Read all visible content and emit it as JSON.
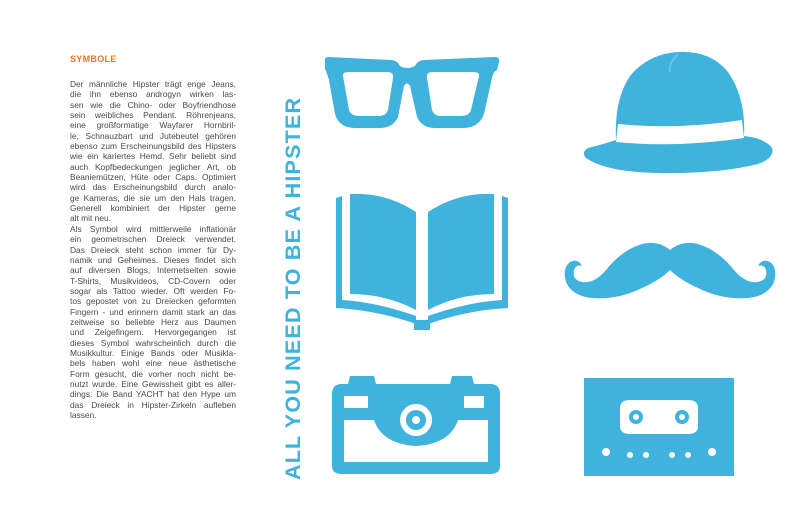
{
  "section_heading": "SYMBOLE",
  "body_lines": [
    "Der männliche Hipster trägt enge Jeans,",
    "die ihn ebenso androgyn wirken las-",
    "sen wie die Chino- oder Boyfriendhose",
    "sein weibliches Pendant. Röhrenjeans,",
    "eine großformatige Wayfarer Hornbril-",
    "le, Schnauzbart und Jutebeutel gehören",
    "ebenso zum Erscheinungsbild des Hipsters",
    "wie ein kariertes Hemd. Sehr beliebt sind",
    "auch Kopfbedeckungen jeglicher Art, ob",
    "Beaniemützen, Hüte oder Caps. Optimiert",
    "wird das Erscheinungsbild durch analo-",
    "ge Kameras, die sie um den Hals tragen.",
    "Generell  kombiniert der Hipster gerne",
    "alt mit neu.",
    "Als Symbol wird mittlerweile inflationär",
    "ein geometrischen Dreieck verwendet.",
    "Das Dreieck steht schon immer für Dy-",
    "namik und Geheimes. Dieses findet sich",
    "auf diversen Blogs, Internetseiten sowie",
    "T-Shirts, Musikvideos, CD-Covern oder",
    "sogar als Tattoo wieder. Oft werden  Fo-",
    "tos gepostet von zu Dreiecken geformten",
    "Fingern - und erinnern damit stark an das",
    "zeitweise so beliebte Herz aus Daumen",
    "und Zeigefingern. Hervorgegangen ist",
    "dieses Symbol wahrscheinlich durch die",
    "Musikkultur. Einige Bands oder Musikla-",
    "bels haben wohl eine neue ästhetische",
    "Form gesucht, die vorher noch nicht be-",
    "nutzt wurde. Eine Gewissheit gibt es aller-",
    "dings: Die Band YACHT hat den Hype um",
    "das Dreieck in Hipster-Zirkeln aufleben",
    "lassen."
  ],
  "vertical_title": "ALL YOU NEED TO BE A HIPSTER",
  "colors": {
    "accent_blue": "#3fb2dd",
    "heading_orange": "#e8752a",
    "body_text": "#4a4a4a",
    "background": "#ffffff"
  },
  "icons": [
    "glasses-icon",
    "hat-icon",
    "book-icon",
    "mustache-icon",
    "camera-icon",
    "cassette-icon"
  ]
}
